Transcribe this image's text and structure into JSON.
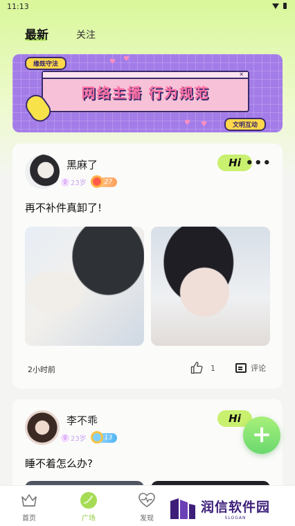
{
  "status_bar": {
    "time": "11:13"
  },
  "tabs": [
    {
      "label": "最新",
      "active": true
    },
    {
      "label": "关注",
      "active": false
    }
  ],
  "banner": {
    "tag": "缘既守法",
    "title": "网络主播 行为规范",
    "action": "文明互动",
    "close": "✕"
  },
  "posts": [
    {
      "username": "黑麻了",
      "age": "23岁",
      "level": "27",
      "hi_label": "Hi",
      "text": "再不补件真卸了!",
      "time_ago": "2小时前",
      "likes": "1",
      "comment_label": "评论"
    },
    {
      "username": "李不乖",
      "age": "23岁",
      "level": "13",
      "hi_label": "Hi",
      "text": "睡不着怎么办?"
    }
  ],
  "fab": {
    "label": "+"
  },
  "bottom_nav": [
    {
      "label": "首页",
      "icon": "crown-icon"
    },
    {
      "label": "广场",
      "icon": "leaf-icon",
      "active": true
    },
    {
      "label": "发现",
      "icon": "heart-pulse-icon"
    }
  ],
  "watermark": {
    "title": "润信软件园",
    "slogan": "SLOGAN"
  },
  "colors": {
    "accent": "#c9f06e",
    "active_nav": "#8fcb3c",
    "banner": "#a37ce8"
  }
}
